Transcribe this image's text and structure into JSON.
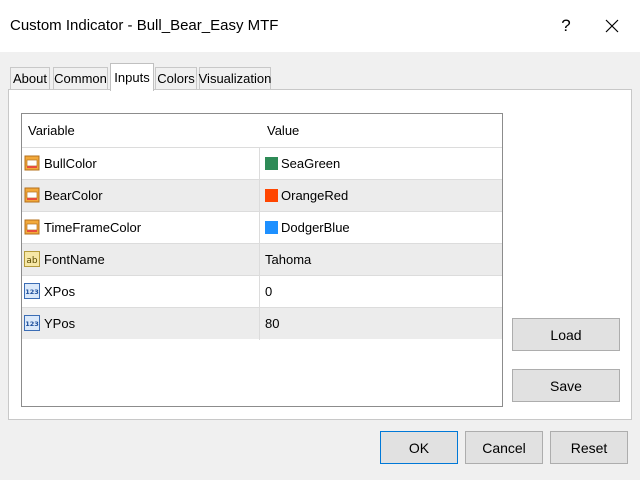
{
  "window": {
    "title": "Custom Indicator - Bull_Bear_Easy MTF",
    "help_label": "?"
  },
  "tabs": [
    {
      "label": "About"
    },
    {
      "label": "Common"
    },
    {
      "label": "Inputs"
    },
    {
      "label": "Colors"
    },
    {
      "label": "Visualization"
    }
  ],
  "active_tab": "Inputs",
  "table": {
    "columns": [
      "Variable",
      "Value"
    ],
    "rows": [
      {
        "name": "BullColor",
        "value": "SeaGreen",
        "type_icon": "color-param-icon",
        "swatch": "#2e8b57"
      },
      {
        "name": "BearColor",
        "value": "OrangeRed",
        "type_icon": "color-param-icon",
        "swatch": "#ff4500"
      },
      {
        "name": "TimeFrameColor",
        "value": "DodgerBlue",
        "type_icon": "color-param-icon",
        "swatch": "#1e90ff"
      },
      {
        "name": "FontName",
        "value": "Tahoma",
        "type_icon": "string-param-icon",
        "icon_text": "ab"
      },
      {
        "name": "XPos",
        "value": "0",
        "type_icon": "integer-param-icon",
        "icon_text": "123"
      },
      {
        "name": "YPos",
        "value": "80",
        "type_icon": "integer-param-icon",
        "icon_text": "123"
      }
    ]
  },
  "side_buttons": {
    "load": "Load",
    "save": "Save"
  },
  "footer_buttons": {
    "ok": "OK",
    "cancel": "Cancel",
    "reset": "Reset"
  },
  "colors": {
    "focus_border": "#0078d7",
    "alt_row": "#ececec",
    "dialog_bg": "#f0f0f0"
  }
}
